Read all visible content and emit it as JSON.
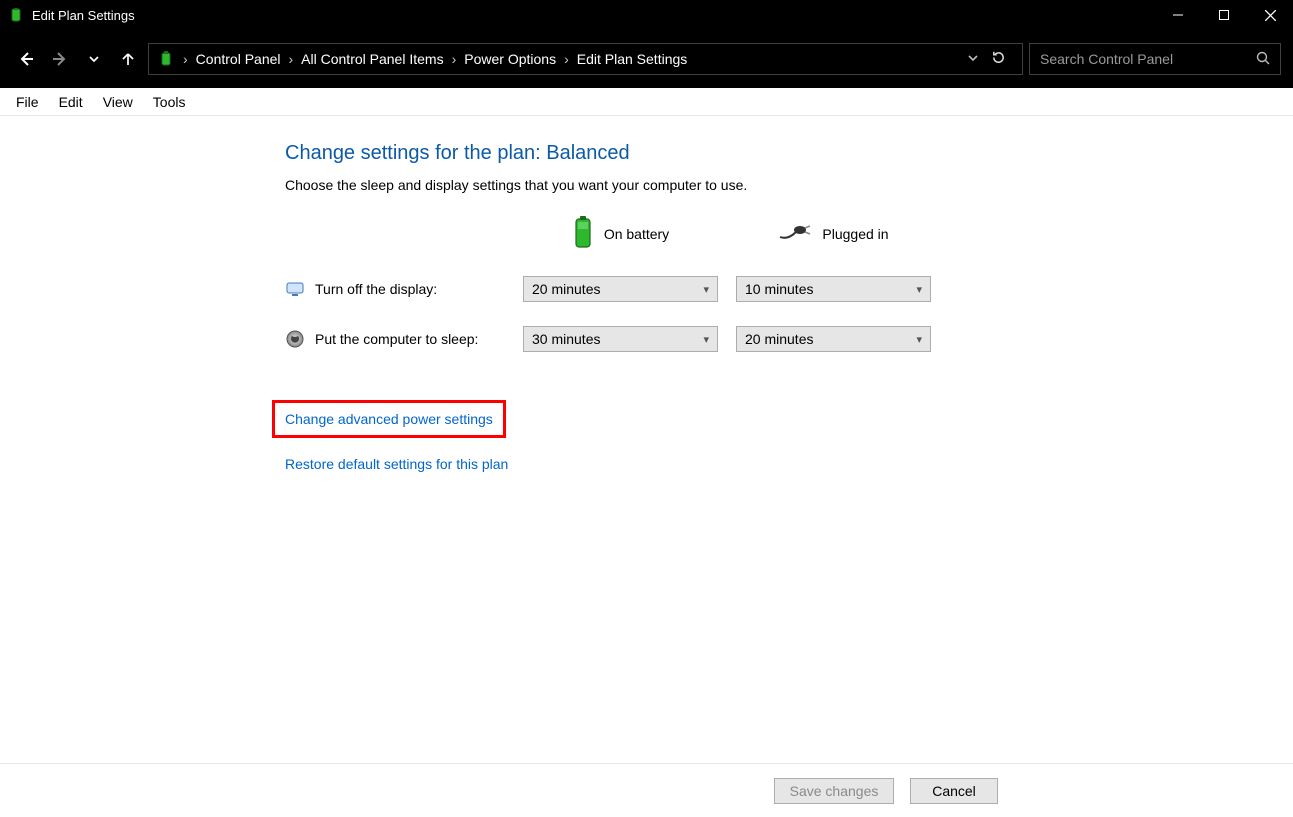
{
  "window": {
    "title": "Edit Plan Settings"
  },
  "breadcrumb": {
    "segments": [
      "Control Panel",
      "All Control Panel Items",
      "Power Options",
      "Edit Plan Settings"
    ]
  },
  "search": {
    "placeholder": "Search Control Panel"
  },
  "menu": {
    "file": "File",
    "edit": "Edit",
    "view": "View",
    "tools": "Tools"
  },
  "page": {
    "title": "Change settings for the plan: Balanced",
    "subtitle": "Choose the sleep and display settings that you want your computer to use."
  },
  "columns": {
    "battery": "On battery",
    "plugged": "Plugged in"
  },
  "rows": {
    "display": {
      "label": "Turn off the display:",
      "battery": "20 minutes",
      "plugged": "10 minutes"
    },
    "sleep": {
      "label": "Put the computer to sleep:",
      "battery": "30 minutes",
      "plugged": "20 minutes"
    }
  },
  "links": {
    "advanced": "Change advanced power settings",
    "restore": "Restore default settings for this plan"
  },
  "buttons": {
    "save": "Save changes",
    "cancel": "Cancel"
  }
}
